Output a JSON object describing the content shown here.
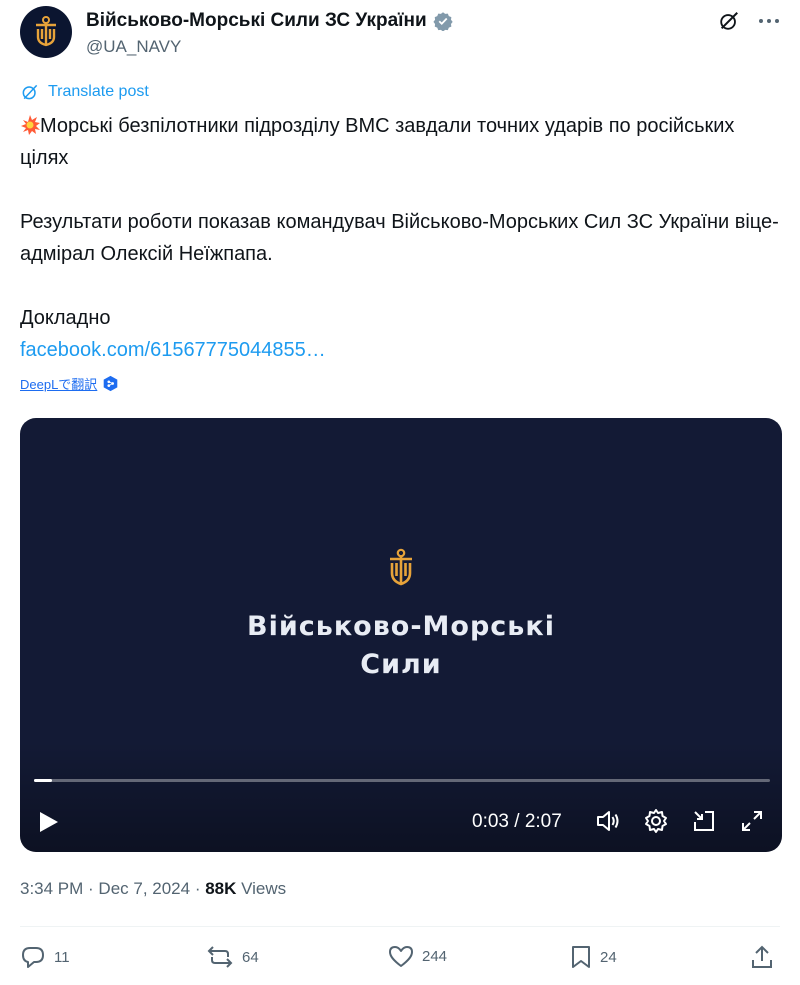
{
  "header": {
    "display_name": "Військово-Морські Сили ЗС України",
    "handle": "@UA_NAVY"
  },
  "translate_label": "Translate post",
  "post": {
    "line1": "Морські безпілотники підрозділу ВМС завдали точних ударів по російських цілях",
    "line2": "Результати роботи показав командувач Військово-Морських Сил ЗС України віце-адмірал Олексій Неїжпапа.",
    "line3": "Докладно",
    "link": "facebook.com/61567775044855…"
  },
  "deepl_label": "DeepLで翻訳",
  "video": {
    "title_line1": "Військово-Морські",
    "title_line2": "Сили",
    "time": "0:03 / 2:07",
    "progress": 0.024
  },
  "meta": {
    "timestamp": "3:34 PM · Dec 7, 2024 · ",
    "views_count": "88K",
    "views_label": " Views"
  },
  "actions": {
    "replies": "11",
    "reposts": "64",
    "likes": "244",
    "bookmarks": "24"
  },
  "colors": {
    "accent": "#1d9bf0",
    "video_bg": "#131a35",
    "logo_gold": "#e7a33a",
    "muted": "#536471"
  },
  "icons": [
    "verified-badge-icon",
    "grok-icon",
    "more-icon",
    "translate-icon",
    "explosion-emoji-icon",
    "deepl-icon",
    "navy-logo-icon",
    "play-icon",
    "volume-icon",
    "settings-icon",
    "pip-icon",
    "fullscreen-icon",
    "reply-icon",
    "repost-icon",
    "like-icon",
    "bookmark-icon",
    "share-icon"
  ]
}
